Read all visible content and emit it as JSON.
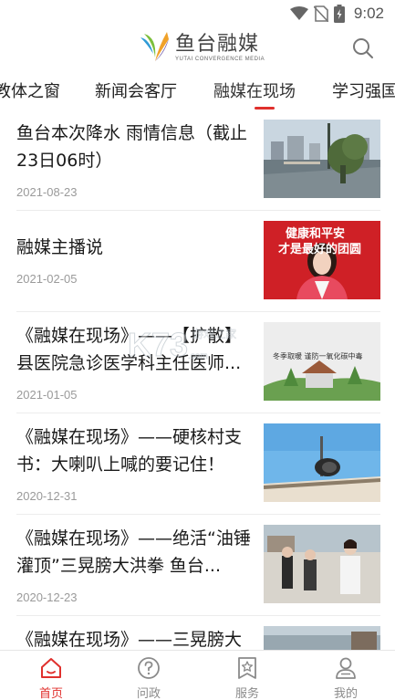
{
  "status_bar": {
    "time": "9:02"
  },
  "header": {
    "logo_cn": "鱼台融媒",
    "logo_en": "YUTAI CONVERGENCE MEDIA"
  },
  "tabs": [
    {
      "label": "教体之窗"
    },
    {
      "label": "新闻会客厅"
    },
    {
      "label": "融媒在现场",
      "active": true
    },
    {
      "label": "学习强国"
    }
  ],
  "articles": [
    {
      "title": "鱼台本次降水 雨情信息（截止23日06时）",
      "date": "2021-08-23"
    },
    {
      "title": "融媒主播说",
      "date": "2021-02-05",
      "thumb_text_1": "健康和平安",
      "thumb_text_2": "才是最好的团圆"
    },
    {
      "title": "《融媒在现场》——【扩散】县医院急诊医学科主任医师...",
      "date": "2021-01-05",
      "thumb_text": "冬季取暖  谨防一氧化碳中毒"
    },
    {
      "title": "《融媒在现场》——硬核村支书：大喇叭上喊的要记住！",
      "date": "2020-12-31"
    },
    {
      "title": "《融媒在现场》——绝活“油锤灌顶”三晃膀大洪拳 鱼台...",
      "date": "2020-12-23"
    },
    {
      "title": "《融媒在现场》——三晃膀大",
      "date": ""
    }
  ],
  "watermark": {
    "text": "K73",
    "sub": "游戏之家",
    "url": ".com"
  },
  "bottom_nav": [
    {
      "label": "首页",
      "icon": "home-icon",
      "active": true
    },
    {
      "label": "问政",
      "icon": "question-icon"
    },
    {
      "label": "服务",
      "icon": "star-bookmark-icon"
    },
    {
      "label": "我的",
      "icon": "user-icon"
    }
  ],
  "colors": {
    "accent": "#e0302d",
    "text": "#1a1a1a",
    "muted": "#9a9a9a"
  }
}
